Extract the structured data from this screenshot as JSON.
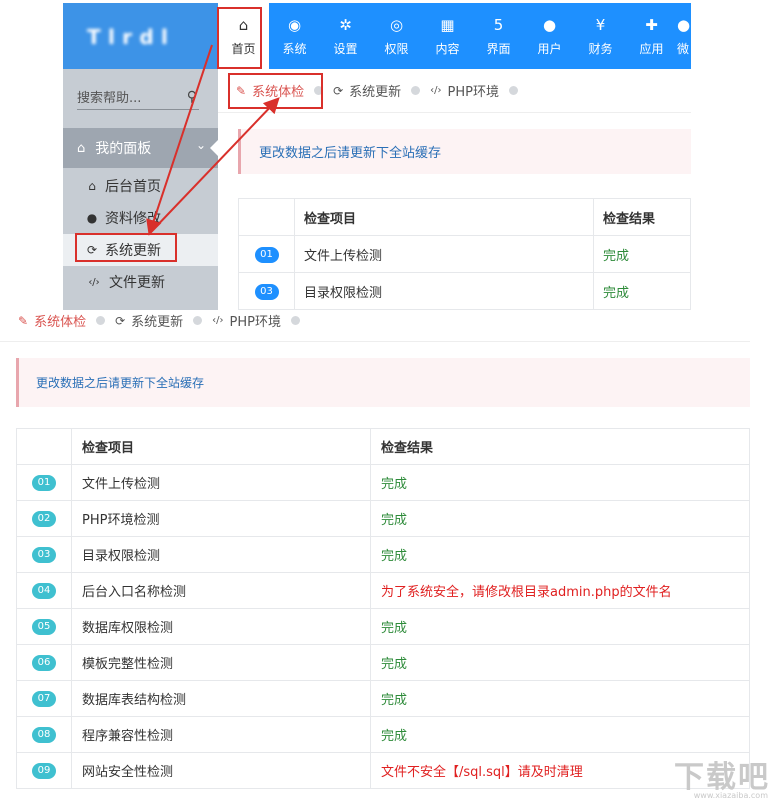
{
  "top": {
    "logo_text": "T l r d l",
    "nav": [
      {
        "label": "首页",
        "icon": "home-icon",
        "glyph": "⌂"
      },
      {
        "label": "系统",
        "icon": "globe-icon",
        "glyph": "◉"
      },
      {
        "label": "设置",
        "icon": "cogs-icon",
        "glyph": "✲"
      },
      {
        "label": "权限",
        "icon": "user-circle-icon",
        "glyph": "◎"
      },
      {
        "label": "内容",
        "icon": "th-large-icon",
        "glyph": "▦"
      },
      {
        "label": "界面",
        "icon": "html5-icon",
        "glyph": "5"
      },
      {
        "label": "用户",
        "icon": "user-icon",
        "glyph": "●"
      },
      {
        "label": "财务",
        "icon": "yen-icon",
        "glyph": "¥"
      },
      {
        "label": "应用",
        "icon": "puzzle-icon",
        "glyph": "✚"
      },
      {
        "label": "微",
        "icon": "wechat-icon",
        "glyph": "●"
      }
    ],
    "search_placeholder": "搜索帮助...",
    "panel_title": "我的面板",
    "side_items": [
      {
        "label": "后台首页",
        "icon": "home-icon",
        "glyph": "⌂"
      },
      {
        "label": "资料修改",
        "icon": "user-icon",
        "glyph": "●"
      },
      {
        "label": "系统更新",
        "icon": "refresh-icon",
        "glyph": "⟳"
      },
      {
        "label": "文件更新",
        "icon": "code-icon",
        "glyph": "‹/›"
      }
    ],
    "tabs": [
      "系统体检",
      "系统更新",
      "PHP环境"
    ],
    "notice": "更改数据之后请更新下全站缓存",
    "table_headers": [
      "检查项目",
      "检查结果"
    ],
    "rows": [
      {
        "num": "01",
        "item": "文件上传检测",
        "result": "完成"
      },
      {
        "num": "03",
        "item": "目录权限检测",
        "result": "完成"
      }
    ]
  },
  "bottom": {
    "tabs": [
      "系统体检",
      "系统更新",
      "PHP环境"
    ],
    "notice": "更改数据之后请更新下全站缓存",
    "table_headers": [
      "检查项目",
      "检查结果"
    ],
    "rows": [
      {
        "num": "01",
        "item": "文件上传检测",
        "result": "完成",
        "status": "ok"
      },
      {
        "num": "02",
        "item": "PHP环境检测",
        "result": "完成",
        "status": "ok"
      },
      {
        "num": "03",
        "item": "目录权限检测",
        "result": "完成",
        "status": "ok"
      },
      {
        "num": "04",
        "item": "后台入口名称检测",
        "result": "为了系统安全，请修改根目录admin.php的文件名",
        "status": "warn"
      },
      {
        "num": "05",
        "item": "数据库权限检测",
        "result": "完成",
        "status": "ok"
      },
      {
        "num": "06",
        "item": "模板完整性检测",
        "result": "完成",
        "status": "ok"
      },
      {
        "num": "07",
        "item": "数据库表结构检测",
        "result": "完成",
        "status": "ok"
      },
      {
        "num": "08",
        "item": "程序兼容性检测",
        "result": "完成",
        "status": "ok"
      },
      {
        "num": "09",
        "item": "网站安全性检测",
        "result": "文件不安全【/sql.sql】请及时清理",
        "status": "warn"
      }
    ]
  },
  "watermark": {
    "main": "下载吧",
    "sub": "www.xiazaiba.com"
  },
  "colors": {
    "nav_bg": "#1e90ff",
    "logo_bg": "#3d93e7",
    "sidebar_bg": "#c6ccd3",
    "ok": "#2e8b3a",
    "warn": "#e02020",
    "highlight": "#d9302b",
    "pill_blue": "#1e90ff",
    "pill_teal": "#3fc0d0"
  }
}
